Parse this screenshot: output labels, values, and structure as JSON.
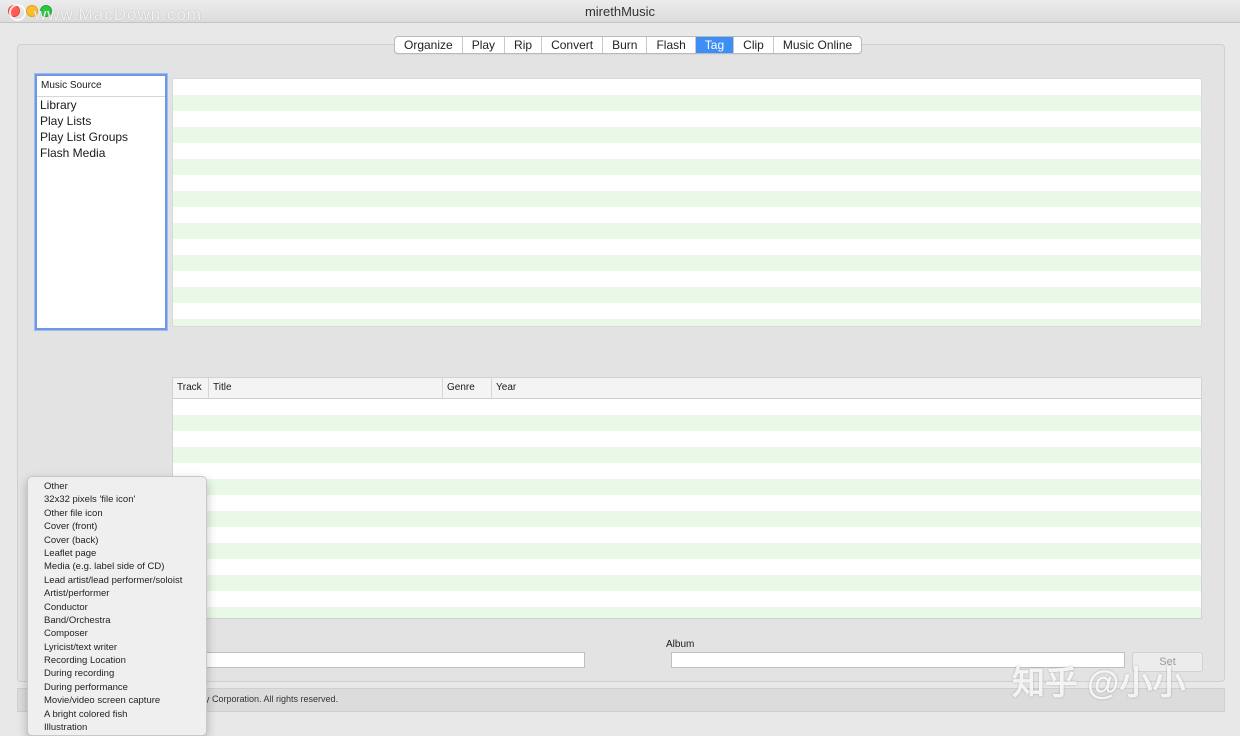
{
  "window": {
    "title": "mirethMusic",
    "watermark": "www.MacDown.com"
  },
  "tabs": [
    {
      "label": "Organize",
      "active": false
    },
    {
      "label": "Play",
      "active": false
    },
    {
      "label": "Rip",
      "active": false
    },
    {
      "label": "Convert",
      "active": false
    },
    {
      "label": "Burn",
      "active": false
    },
    {
      "label": "Flash",
      "active": false
    },
    {
      "label": "Tag",
      "active": true
    },
    {
      "label": "Clip",
      "active": false
    },
    {
      "label": "Music Online",
      "active": false
    }
  ],
  "music_source": {
    "header": "Music Source",
    "items": [
      "Library",
      "Play Lists",
      "Play List Groups",
      "Flash Media"
    ]
  },
  "track_table": {
    "columns": [
      "Track",
      "Title",
      "Genre",
      "Year"
    ]
  },
  "form": {
    "album_label": "Album",
    "set_button": "Set"
  },
  "status": {
    "copyright": "gy Corporation. All rights reserved."
  },
  "overlay_watermark": "知乎 @小小",
  "picture_type_menu": [
    "Other",
    "32x32 pixels 'file icon'",
    "Other file icon",
    "Cover (front)",
    "Cover (back)",
    "Leaflet page",
    "Media (e.g. label side of CD)",
    "Lead artist/lead performer/soloist",
    "Artist/performer",
    "Conductor",
    "Band/Orchestra",
    "Composer",
    "Lyricist/text writer",
    "Recording Location",
    "During recording",
    "During performance",
    "Movie/video screen capture",
    "A bright colored fish",
    "Illustration"
  ],
  "colors": {
    "active_tab": "#3d8ff5",
    "stripe": "#e9f9e7",
    "focus_border": "#6e97e6"
  }
}
